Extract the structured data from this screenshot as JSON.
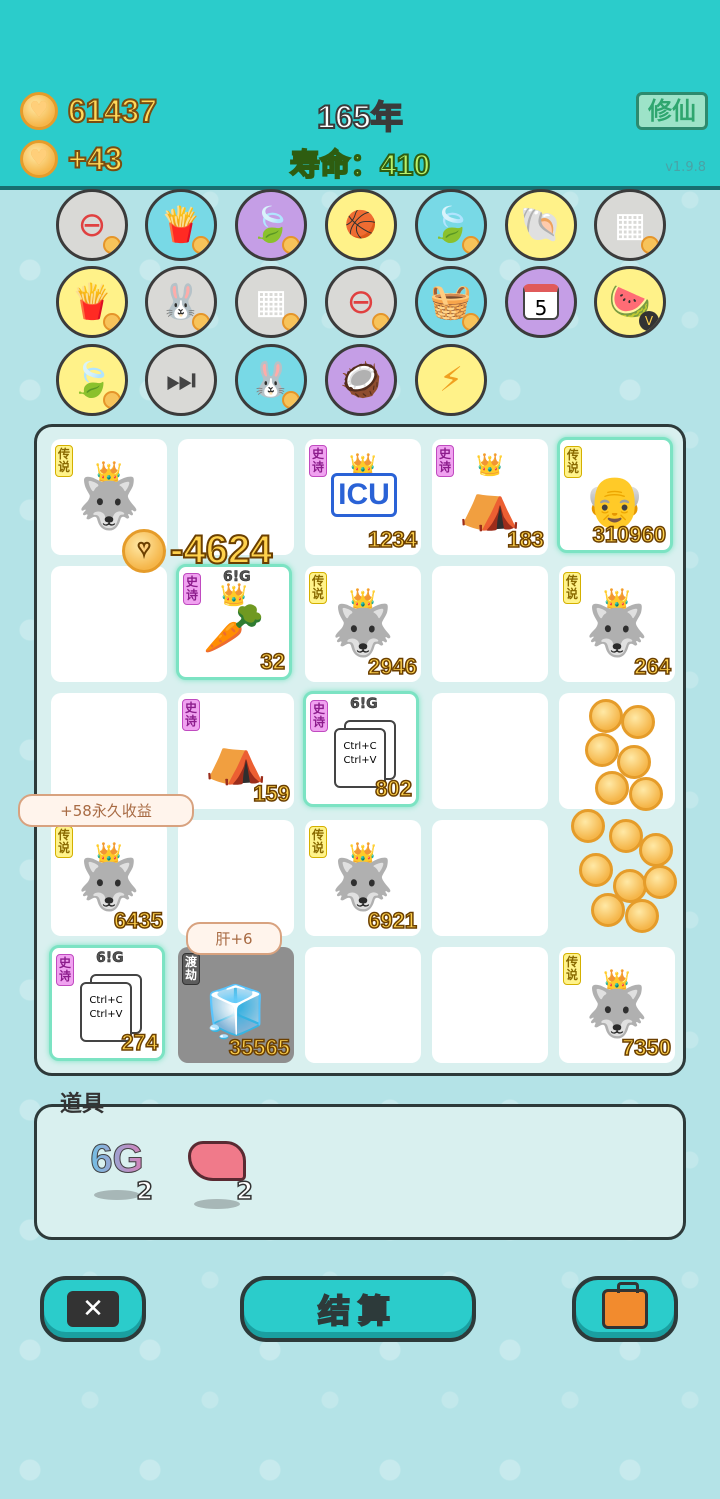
{
  "header": {
    "coins": "61437",
    "income": "+43",
    "year": "165年",
    "lifespan": "寿命：410",
    "xiuxian_label": "修仙",
    "version": "v1.9.8"
  },
  "icon_rows": [
    [
      "minus-circle-icon",
      "fries-icon",
      "leaf-icon",
      "balls-icon",
      "leaf-icon",
      "shell-icon",
      "cubes-icon"
    ],
    [
      "fries-icon",
      "rabbit-icon",
      "cubes-icon",
      "minus-circle-icon",
      "fruit-basket-icon",
      "calendar-icon",
      "fruit-plate-icon"
    ],
    [
      "leaf-icon",
      "skip-icon",
      "rabbit-icon",
      "mask-icon",
      "lightning-icon"
    ]
  ],
  "calendar_day": "5",
  "fruit_badge": "V",
  "board": {
    "cells": [
      {
        "tag": "传说",
        "count": ""
      },
      {
        "tag": "",
        "count": ""
      },
      {
        "tag": "史诗",
        "count": "1234",
        "label": "ICU"
      },
      {
        "tag": "史诗",
        "count": "183"
      },
      {
        "tag": "传说",
        "count": "310960"
      },
      {
        "tag": "",
        "count": ""
      },
      {
        "tag": "史诗",
        "count": "32",
        "top_label": "6!G"
      },
      {
        "tag": "传说",
        "count": "2946"
      },
      {
        "tag": "",
        "count": ""
      },
      {
        "tag": "传说",
        "count": "264"
      },
      {
        "tag": "",
        "count": ""
      },
      {
        "tag": "史诗",
        "count": "159"
      },
      {
        "tag": "史诗",
        "count": "802",
        "top_label": "6!G",
        "card_line1": "Ctrl+C",
        "card_line2": "Ctrl+V"
      },
      {
        "tag": "",
        "count": ""
      },
      {
        "tag": "",
        "count": ""
      },
      {
        "tag": "传说",
        "count": "6435"
      },
      {
        "tag": "",
        "count": ""
      },
      {
        "tag": "传说",
        "count": "6921"
      },
      {
        "tag": "",
        "count": ""
      },
      {
        "tag": "",
        "count": ""
      },
      {
        "tag": "史诗",
        "count": "274",
        "top_label": "6!G",
        "card_line1": "Ctrl+C",
        "card_line2": "Ctrl+V"
      },
      {
        "tag": "渡劫",
        "count": "35565"
      },
      {
        "tag": "",
        "count": ""
      },
      {
        "tag": "",
        "count": ""
      },
      {
        "tag": "传说",
        "count": "7350"
      }
    ],
    "floating_loss": "-4624",
    "bubble_permanent": "+58永久收益",
    "bubble_liver": "肝+6"
  },
  "items": {
    "title": "道具",
    "list": [
      {
        "name": "6G",
        "count": "2"
      },
      {
        "name": "liver",
        "count": "2"
      }
    ]
  },
  "buttons": {
    "settle": "结算"
  }
}
